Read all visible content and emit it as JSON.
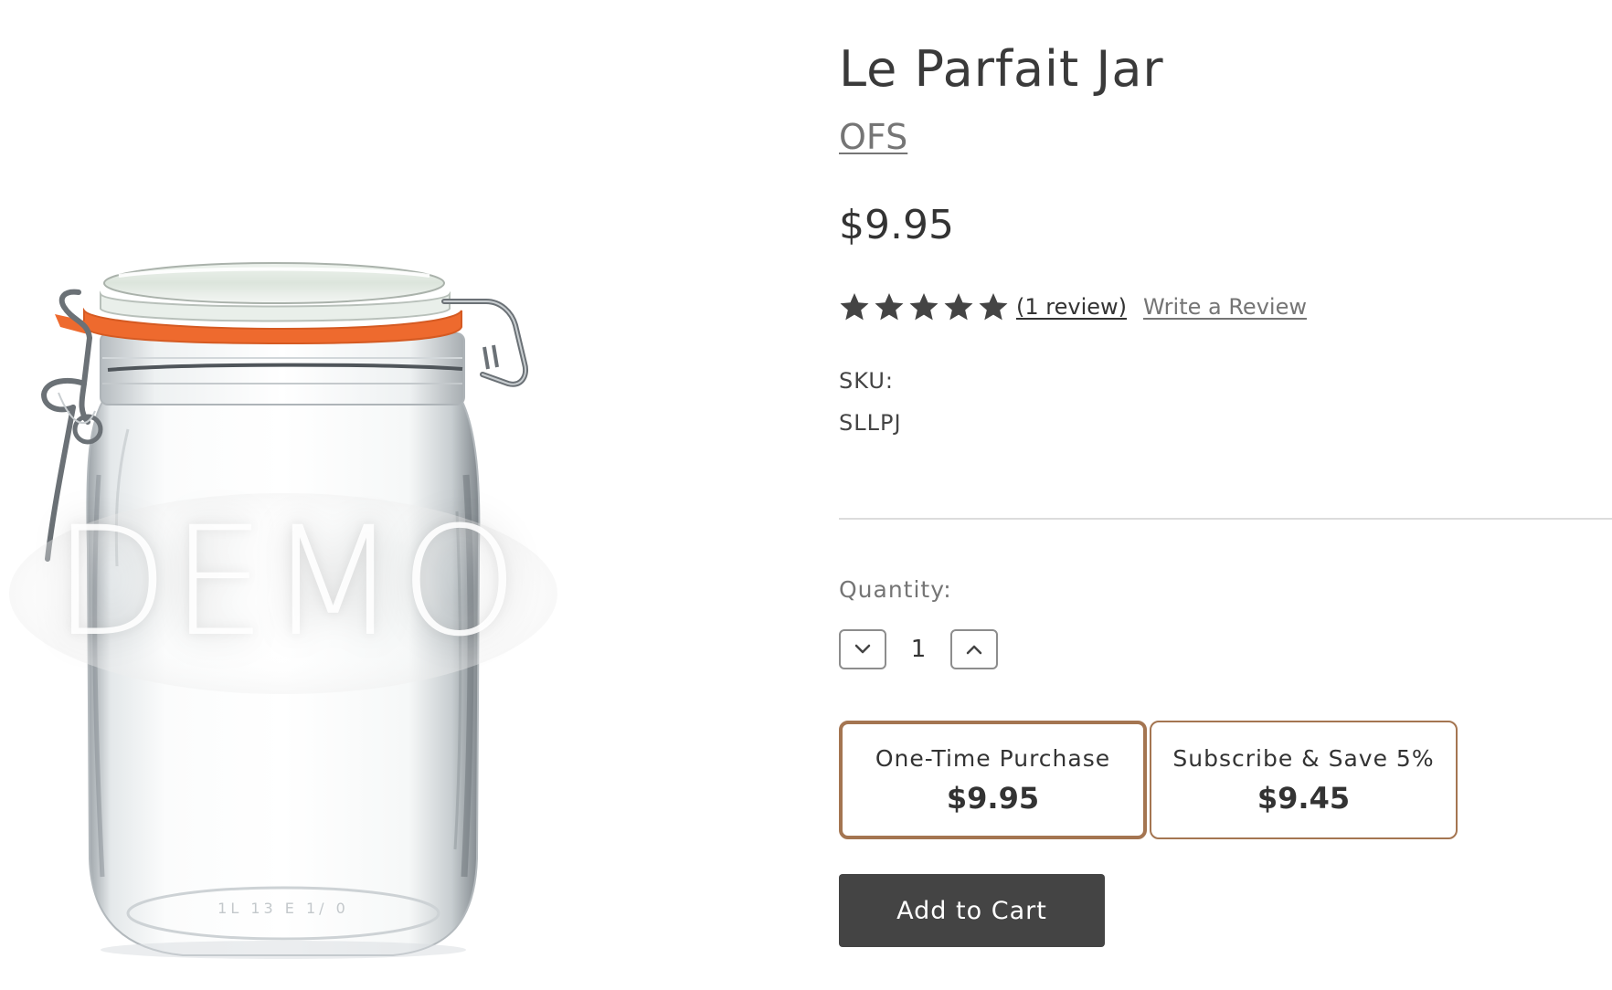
{
  "product": {
    "title": "Le Parfait Jar",
    "brand": "OFS",
    "price": "$9.95",
    "image_watermark": "DEMO",
    "image_embossed_text": "1L 13 E 1/ 0"
  },
  "rating": {
    "stars": 5,
    "max_stars": 5,
    "icon": "star-icon",
    "review_count_text": "(1 review)",
    "write_review_text": "Write a Review"
  },
  "sku": {
    "label": "SKU:",
    "value": "SLLPJ"
  },
  "quantity": {
    "label": "Quantity:",
    "value": "1",
    "decrement_icon": "chevron-down-icon",
    "increment_icon": "chevron-up-icon"
  },
  "purchase_options": [
    {
      "label": "One-Time Purchase",
      "price": "$9.95",
      "selected": true
    },
    {
      "label": "Subscribe & Save 5%",
      "price": "$9.45",
      "selected": false
    }
  ],
  "cart": {
    "button_label": "Add to Cart"
  },
  "colors": {
    "text_dark": "#333333",
    "text_muted": "#757575",
    "option_border": "#a47551",
    "button_bg": "#444444",
    "star": "#444444",
    "jar_seal": "#ee6a2e"
  }
}
